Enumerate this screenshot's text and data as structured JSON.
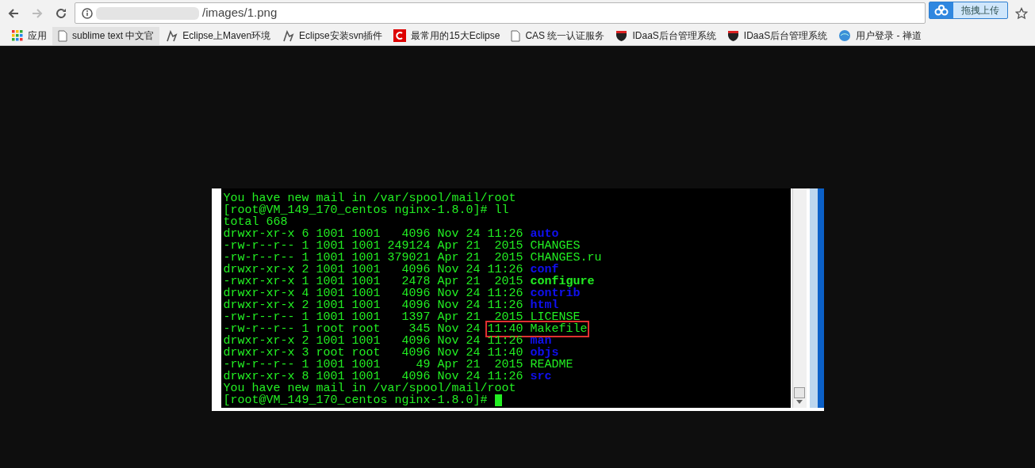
{
  "browser": {
    "url": "/images/1.png",
    "extension_button": "拖拽上传"
  },
  "bookmarks": [
    {
      "label": "应用",
      "kind": "apps"
    },
    {
      "label": "sublime text 中文官",
      "kind": "page",
      "selected": true
    },
    {
      "label": "Eclipse上Maven环境",
      "kind": "bird",
      "selected": false
    },
    {
      "label": "Eclipse安装svn插件",
      "kind": "bird",
      "selected": false
    },
    {
      "label": "最常用的15大Eclipse",
      "kind": "redc",
      "selected": false
    },
    {
      "label": "CAS 统一认证服务",
      "kind": "page",
      "selected": false
    },
    {
      "label": "IDaaS后台管理系统",
      "kind": "shield",
      "selected": false
    },
    {
      "label": "IDaaS后台管理系统",
      "kind": "shield",
      "selected": false
    },
    {
      "label": "用户登录 - 禅道",
      "kind": "globe",
      "selected": false
    }
  ],
  "terminal": {
    "lines": [
      {
        "kind": "text",
        "text": "You have new mail in /var/spool/mail/root"
      },
      {
        "kind": "text",
        "text": "[root@VM_149_170_centos nginx-1.8.0]# ll"
      },
      {
        "kind": "text",
        "text": "total 668"
      },
      {
        "kind": "dir",
        "info": "drwxr-xr-x 6 1001 1001   4096 Nov 24 11:26",
        "name": "auto",
        "highlighted": false
      },
      {
        "kind": "file",
        "info": "-rw-r--r-- 1 1001 1001 249124 Apr 21  2015",
        "name": "CHANGES",
        "highlighted": false
      },
      {
        "kind": "file",
        "info": "-rw-r--r-- 1 1001 1001 379021 Apr 21  2015",
        "name": "CHANGES.ru",
        "highlighted": false
      },
      {
        "kind": "dir",
        "info": "drwxr-xr-x 2 1001 1001   4096 Nov 24 11:26",
        "name": "conf",
        "highlighted": false
      },
      {
        "kind": "exec",
        "info": "-rwxr-xr-x 1 1001 1001   2478 Apr 21  2015",
        "name": "configure",
        "highlighted": false
      },
      {
        "kind": "dir",
        "info": "drwxr-xr-x 4 1001 1001   4096 Nov 24 11:26",
        "name": "contrib",
        "highlighted": false
      },
      {
        "kind": "dir",
        "info": "drwxr-xr-x 2 1001 1001   4096 Nov 24 11:26",
        "name": "html",
        "highlighted": false
      },
      {
        "kind": "file",
        "info": "-rw-r--r-- 1 1001 1001   1397 Apr 21  2015",
        "name": "LICENSE",
        "highlighted": false
      },
      {
        "kind": "file",
        "info": "-rw-r--r-- 1 root root    345 Nov 24 11:40",
        "name": "Makefile",
        "highlighted": true
      },
      {
        "kind": "dir",
        "info": "drwxr-xr-x 2 1001 1001   4096 Nov 24 11:26",
        "name": "man",
        "highlighted": false
      },
      {
        "kind": "dir",
        "info": "drwxr-xr-x 3 root root   4096 Nov 24 11:40",
        "name": "objs",
        "highlighted": false
      },
      {
        "kind": "file",
        "info": "-rw-r--r-- 1 1001 1001     49 Apr 21  2015",
        "name": "README",
        "highlighted": false
      },
      {
        "kind": "dir",
        "info": "drwxr-xr-x 8 1001 1001   4096 Nov 24 11:26",
        "name": "src",
        "highlighted": false
      },
      {
        "kind": "text",
        "text": "You have new mail in /var/spool/mail/root"
      },
      {
        "kind": "prompt",
        "text": "[root@VM_149_170_centos nginx-1.8.0]#"
      }
    ]
  }
}
